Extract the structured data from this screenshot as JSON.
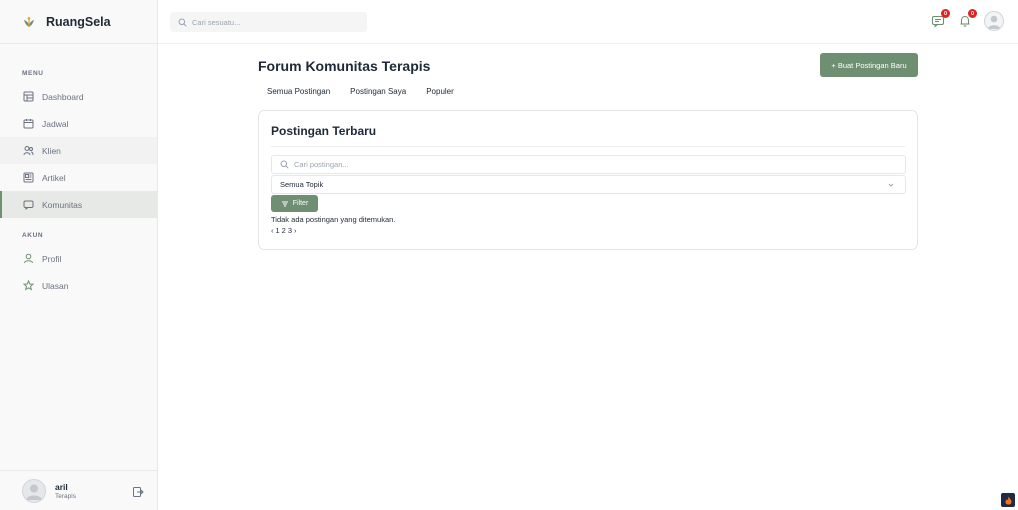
{
  "brand": {
    "name": "RuangSela",
    "color": "#6f8f72"
  },
  "sidebar": {
    "menu_label": "MENU",
    "menu_items": [
      {
        "label": "Dashboard",
        "icon": "dashboard-icon"
      },
      {
        "label": "Jadwal",
        "icon": "calendar-icon"
      },
      {
        "label": "Klien",
        "icon": "users-icon"
      },
      {
        "label": "Artikel",
        "icon": "article-icon"
      },
      {
        "label": "Komunitas",
        "icon": "chat-icon",
        "active": true
      }
    ],
    "account_label": "AKUN",
    "account_items": [
      {
        "label": "Profil",
        "icon": "user-icon"
      },
      {
        "label": "Ulasan",
        "icon": "star-icon"
      }
    ],
    "user": {
      "name": "aril",
      "role": "Terapis"
    }
  },
  "topbar": {
    "search_placeholder": "Cari sesuatu...",
    "messages_badge": "0",
    "notifications_badge": "0"
  },
  "main": {
    "title": "Forum Komunitas Terapis",
    "new_post_button": "+ Buat Postingan Baru",
    "tabs": [
      "Semua Postingan",
      "Postingan Saya",
      "Populer"
    ],
    "card": {
      "title": "Postingan Terbaru",
      "search_placeholder": "Cari postingan...",
      "topic_select_value": "Semua Topik",
      "filter_button": "Filter",
      "empty_message": "Tidak ada postingan yang ditemukan.",
      "pagination": {
        "prev": "‹",
        "pages": [
          "1",
          "2",
          "3"
        ],
        "next": "›"
      }
    }
  },
  "colors": {
    "accent": "#6f8f72",
    "badge": "#e02424"
  }
}
